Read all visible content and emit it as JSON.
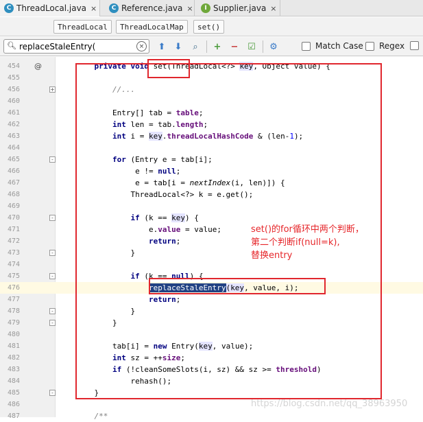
{
  "tabs": [
    {
      "label": "ThreadLocal.java",
      "icon": "C",
      "active": true
    },
    {
      "label": "Reference.java",
      "icon": "C",
      "active": false
    },
    {
      "label": "Supplier.java",
      "icon": "I",
      "active": false
    }
  ],
  "tab_close": "×",
  "breadcrumbs": [
    "ThreadLocal",
    "ThreadLocalMap",
    "set()"
  ],
  "search": {
    "value": "replaceStaleEntry(",
    "clear": "×"
  },
  "options": {
    "match_case": "Match Case",
    "regex": "Regex"
  },
  "lines": [
    {
      "n": "454",
      "html": "    <span class=\"kw\">private void</span> set(ThreadLocal&lt;?&gt; <span class=\"par\">key</span>, Object value) {",
      "mark": "@"
    },
    {
      "n": "455",
      "html": ""
    },
    {
      "n": "456",
      "html": "        <span class=\"cmt\">//...</span>",
      "fold": "+"
    },
    {
      "n": "460",
      "html": ""
    },
    {
      "n": "461",
      "html": "        Entry[] tab = <span class=\"fld\">table</span>;"
    },
    {
      "n": "462",
      "html": "        <span class=\"kw\">int</span> len = tab.<span class=\"fld\">length</span>;"
    },
    {
      "n": "463",
      "html": "        <span class=\"kw\">int</span> i = <span class=\"par\">key</span>.<span class=\"fld\">threadLocalHashCode</span> &amp; (len-<span class=\"num\">1</span>);"
    },
    {
      "n": "464",
      "html": ""
    },
    {
      "n": "465",
      "html": "        <span class=\"kw\">for</span> (Entry e = tab[i];",
      "fold": "-"
    },
    {
      "n": "466",
      "html": "             e != <span class=\"kw\">null</span>;"
    },
    {
      "n": "467",
      "html": "             e = tab[i = <span class=\"ital\">nextIndex</span>(i, len)]) {"
    },
    {
      "n": "468",
      "html": "            ThreadLocal&lt;?&gt; k = e.get();"
    },
    {
      "n": "469",
      "html": ""
    },
    {
      "n": "470",
      "html": "            <span class=\"kw\">if</span> (k == <span class=\"par\">key</span>) {",
      "fold": "-"
    },
    {
      "n": "471",
      "html": "                e.<span class=\"fld\">value</span> = value;"
    },
    {
      "n": "472",
      "html": "                <span class=\"kw\">return</span>;"
    },
    {
      "n": "473",
      "html": "            }",
      "fold": "-"
    },
    {
      "n": "474",
      "html": ""
    },
    {
      "n": "475",
      "html": "            <span class=\"kw\">if</span> (k == <span class=\"kw\">null</span>) {",
      "fold": "-"
    },
    {
      "n": "476",
      "html": "                <span class=\"sel\">replaceStaleEntry</span><span class=\"par\">(</span><span class=\"par\">key</span>, value, i);",
      "hl": true
    },
    {
      "n": "477",
      "html": "                <span class=\"kw\">return</span>;"
    },
    {
      "n": "478",
      "html": "            }",
      "fold": "-"
    },
    {
      "n": "479",
      "html": "        }",
      "fold": "-"
    },
    {
      "n": "480",
      "html": ""
    },
    {
      "n": "481",
      "html": "        tab[i] = <span class=\"kw\">new</span> Entry(<span class=\"par\">key</span>, value);"
    },
    {
      "n": "482",
      "html": "        <span class=\"kw\">int</span> sz = ++<span class=\"fld\">size</span>;"
    },
    {
      "n": "483",
      "html": "        <span class=\"kw\">if</span> (!cleanSomeSlots(i, sz) &amp;&amp; sz &gt;= <span class=\"fld\">threshold</span>)"
    },
    {
      "n": "484",
      "html": "            rehash();"
    },
    {
      "n": "485",
      "html": "    }",
      "fold": "-"
    },
    {
      "n": "486",
      "html": ""
    },
    {
      "n": "487",
      "html": "    <span class=\"cmt\">/**</span>"
    }
  ],
  "annotation": [
    "set()的for循环中两个判断，",
    "第二个判断if(null=k),",
    "替换entry"
  ],
  "watermark": "https://blog.csdn.net/qq_38963950",
  "colors": {
    "accent_red": "#e0262d",
    "keyword": "#000080",
    "field": "#660e7a"
  }
}
